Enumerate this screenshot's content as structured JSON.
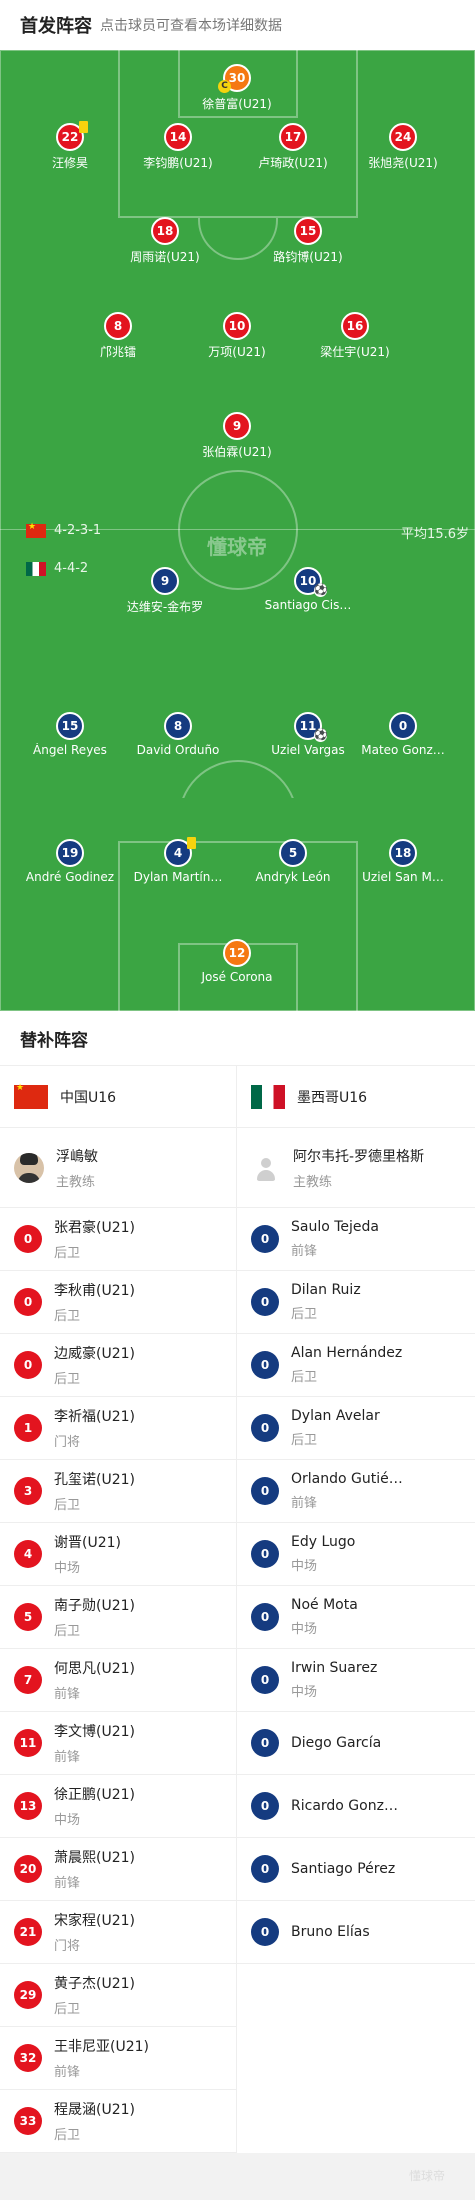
{
  "header": {
    "title": "首发阵容",
    "subtitle": "点击球员可查看本场详细数据"
  },
  "watermark": "懂球帝",
  "home": {
    "formation": "4-2-3-1",
    "avg_age": "平均15.6岁",
    "team": "中国U16",
    "color": "#e3141f",
    "goalkeeper": {
      "number": "30",
      "name": "徐普富(U21)",
      "captain": "C"
    },
    "defenders": [
      {
        "number": "22",
        "name": "汪修昊",
        "yellow": true
      },
      {
        "number": "14",
        "name": "李钧鹏(U21)"
      },
      {
        "number": "17",
        "name": "卢琦政(U21)"
      },
      {
        "number": "24",
        "name": "张旭尧(U21)"
      }
    ],
    "dm": [
      {
        "number": "18",
        "name": "周雨诺(U21)"
      },
      {
        "number": "15",
        "name": "路钧博(U21)"
      }
    ],
    "am": [
      {
        "number": "8",
        "name": "邝兆镭"
      },
      {
        "number": "10",
        "name": "万项(U21)"
      },
      {
        "number": "16",
        "name": "梁仕宇(U21)"
      }
    ],
    "fw": [
      {
        "number": "9",
        "name": "张伯霖(U21)"
      }
    ]
  },
  "away": {
    "formation": "4-4-2",
    "team": "墨西哥U16",
    "color": "#153b80",
    "fw": [
      {
        "number": "9",
        "name": "达维安-金布罗"
      },
      {
        "number": "10",
        "name": "Santiago Cis…",
        "goal": true
      }
    ],
    "mid": [
      {
        "number": "15",
        "name": "Ángel Reyes"
      },
      {
        "number": "8",
        "name": "David Orduño"
      },
      {
        "number": "11",
        "name": "Uziel Vargas",
        "goal": true
      },
      {
        "number": "0",
        "name": "Mateo Gonz…"
      }
    ],
    "def": [
      {
        "number": "19",
        "name": "André Godinez"
      },
      {
        "number": "4",
        "name": "Dylan Martín…",
        "yellow": true
      },
      {
        "number": "5",
        "name": "Andryk León"
      },
      {
        "number": "18",
        "name": "Uziel San M…"
      }
    ],
    "goalkeeper": {
      "number": "12",
      "name": "José Corona"
    }
  },
  "subs_title": "替补阵容",
  "subs": {
    "home": {
      "team": "中国U16",
      "coach": {
        "name": "浮嶋敏",
        "role": "主教练"
      },
      "players": [
        {
          "number": "0",
          "name": "张君豪(U21)",
          "pos": "后卫"
        },
        {
          "number": "0",
          "name": "李秋甫(U21)",
          "pos": "后卫"
        },
        {
          "number": "0",
          "name": "边威豪(U21)",
          "pos": "后卫"
        },
        {
          "number": "1",
          "name": "李祈福(U21)",
          "pos": "门将"
        },
        {
          "number": "3",
          "name": "孔玺诺(U21)",
          "pos": "后卫"
        },
        {
          "number": "4",
          "name": "谢晋(U21)",
          "pos": "中场"
        },
        {
          "number": "5",
          "name": "南子勋(U21)",
          "pos": "后卫"
        },
        {
          "number": "7",
          "name": "何思凡(U21)",
          "pos": "前锋"
        },
        {
          "number": "11",
          "name": "李文博(U21)",
          "pos": "前锋"
        },
        {
          "number": "13",
          "name": "徐正鹏(U21)",
          "pos": "中场"
        },
        {
          "number": "20",
          "name": "萧晨熙(U21)",
          "pos": "前锋"
        },
        {
          "number": "21",
          "name": "宋家程(U21)",
          "pos": "门将"
        },
        {
          "number": "29",
          "name": "黄子杰(U21)",
          "pos": "后卫"
        },
        {
          "number": "32",
          "name": "王非尼亚(U21)",
          "pos": "前锋"
        },
        {
          "number": "33",
          "name": "程晟涵(U21)",
          "pos": "后卫"
        }
      ]
    },
    "away": {
      "team": "墨西哥U16",
      "coach": {
        "name": "阿尔韦托-罗德里格斯",
        "role": "主教练"
      },
      "players": [
        {
          "number": "0",
          "name": "Saulo Tejeda",
          "pos": "前锋"
        },
        {
          "number": "0",
          "name": "Dilan Ruiz",
          "pos": "后卫"
        },
        {
          "number": "0",
          "name": "Alan Hernández",
          "pos": "后卫"
        },
        {
          "number": "0",
          "name": "Dylan Avelar",
          "pos": "后卫"
        },
        {
          "number": "0",
          "name": "Orlando Gutié…",
          "pos": "前锋"
        },
        {
          "number": "0",
          "name": "Edy Lugo",
          "pos": "中场"
        },
        {
          "number": "0",
          "name": "Noé Mota",
          "pos": "中场"
        },
        {
          "number": "0",
          "name": "Irwin Suarez",
          "pos": "中场"
        },
        {
          "number": "0",
          "name": "Diego García",
          "pos": ""
        },
        {
          "number": "0",
          "name": "Ricardo Gonz…",
          "pos": ""
        },
        {
          "number": "0",
          "name": "Santiago Pérez",
          "pos": ""
        },
        {
          "number": "0",
          "name": "Bruno Elías",
          "pos": ""
        }
      ]
    }
  },
  "icons": {
    "captain": "captain-badge-icon",
    "goal": "football-icon",
    "card": "yellow-card-icon"
  }
}
